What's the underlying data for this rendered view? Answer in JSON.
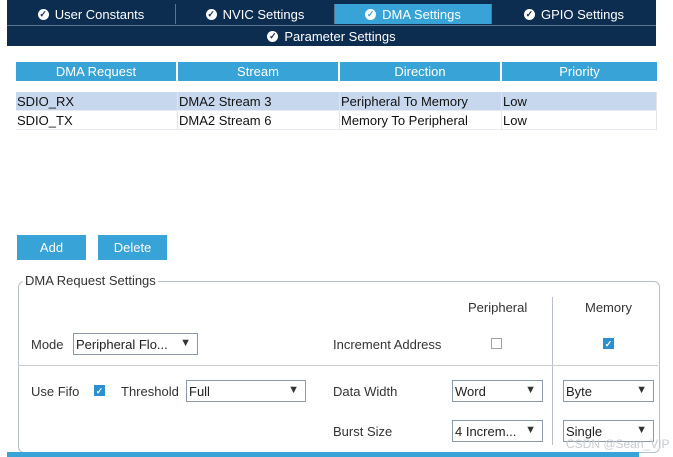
{
  "tabs": [
    {
      "label": "User Constants",
      "active": false
    },
    {
      "label": "NVIC Settings",
      "active": false
    },
    {
      "label": "DMA Settings",
      "active": true
    },
    {
      "label": "GPIO Settings",
      "active": false
    }
  ],
  "subtab": {
    "label": "Parameter Settings"
  },
  "table": {
    "columns": [
      "DMA Request",
      "Stream",
      "Direction",
      "Priority"
    ],
    "rows": [
      [
        "SDIO_RX",
        "DMA2 Stream 3",
        "Peripheral To Memory",
        "Low"
      ],
      [
        "SDIO_TX",
        "DMA2 Stream 6",
        "Memory To Peripheral",
        "Low"
      ]
    ],
    "selected_row": 0
  },
  "buttons": {
    "add": "Add",
    "delete": "Delete"
  },
  "settings": {
    "title": "DMA Request Settings",
    "peripheral_header": "Peripheral",
    "memory_header": "Memory",
    "mode_label": "Mode",
    "mode_value": "Peripheral Flo...",
    "increment_label": "Increment Address",
    "increment_peripheral": false,
    "increment_memory": true,
    "use_fifo_label": "Use Fifo",
    "use_fifo": true,
    "threshold_label": "Threshold",
    "threshold_value": "Full",
    "data_width_label": "Data Width",
    "data_width_peripheral": "Word",
    "data_width_memory": "Byte",
    "burst_label": "Burst Size",
    "burst_peripheral": "4 Increm...",
    "burst_memory": "Single"
  },
  "watermark": "CSDN @Sean_VIP",
  "colors": {
    "navy": "#0c2c50",
    "accent": "#38a3d6",
    "selected_row": "#c7d8ee"
  }
}
